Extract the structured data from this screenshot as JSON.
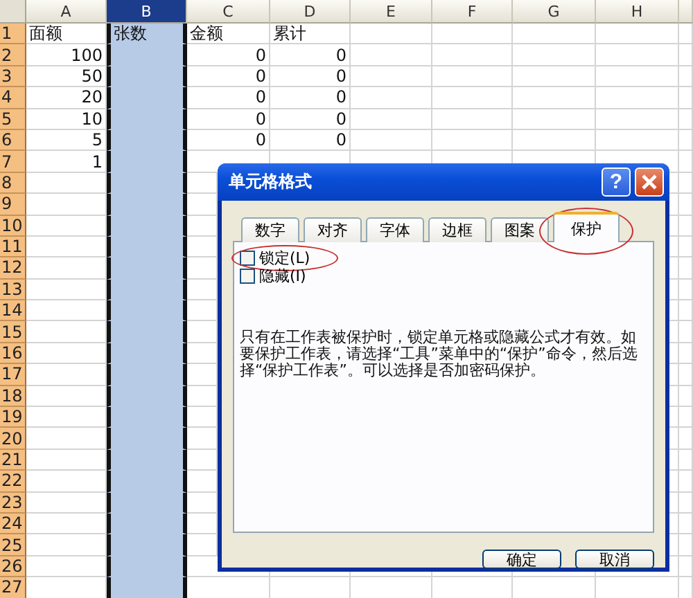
{
  "columns": [
    {
      "label": "A",
      "selected": false
    },
    {
      "label": "B",
      "selected": true
    },
    {
      "label": "C",
      "selected": false
    },
    {
      "label": "D",
      "selected": false
    },
    {
      "label": "E",
      "selected": false
    },
    {
      "label": "F",
      "selected": false
    },
    {
      "label": "G",
      "selected": false
    },
    {
      "label": "H",
      "selected": false
    }
  ],
  "rows": [
    {
      "label": "1",
      "kind": "text",
      "cells": [
        "面额",
        "张数",
        "金额",
        "累计"
      ]
    },
    {
      "label": "2",
      "kind": "number",
      "cells": [
        "100",
        "",
        "0",
        "0"
      ]
    },
    {
      "label": "3",
      "kind": "number",
      "cells": [
        "50",
        "",
        "0",
        "0"
      ]
    },
    {
      "label": "4",
      "kind": "number",
      "cells": [
        "20",
        "",
        "0",
        "0"
      ]
    },
    {
      "label": "5",
      "kind": "number",
      "cells": [
        "10",
        "",
        "0",
        "0"
      ]
    },
    {
      "label": "6",
      "kind": "number",
      "cells": [
        "5",
        "",
        "0",
        "0"
      ]
    },
    {
      "label": "7",
      "kind": "number",
      "cells": [
        "1"
      ]
    },
    {
      "label": "8"
    },
    {
      "label": "9"
    },
    {
      "label": "10"
    },
    {
      "label": "11"
    },
    {
      "label": "12"
    },
    {
      "label": "13"
    },
    {
      "label": "14"
    },
    {
      "label": "15"
    },
    {
      "label": "16"
    },
    {
      "label": "17"
    },
    {
      "label": "18"
    },
    {
      "label": "19"
    },
    {
      "label": "20"
    },
    {
      "label": "21"
    },
    {
      "label": "22"
    },
    {
      "label": "23"
    },
    {
      "label": "24"
    },
    {
      "label": "25"
    },
    {
      "label": "26"
    },
    {
      "label": "27"
    }
  ],
  "dialog": {
    "title": "单元格格式",
    "help_button": "?",
    "tabs": [
      {
        "label": "数字",
        "selected": false,
        "circled": false
      },
      {
        "label": "对齐",
        "selected": false,
        "circled": false
      },
      {
        "label": "字体",
        "selected": false,
        "circled": false
      },
      {
        "label": "边框",
        "selected": false,
        "circled": false
      },
      {
        "label": "图案",
        "selected": false,
        "circled": false
      },
      {
        "label": "保护",
        "selected": true,
        "circled": true
      }
    ],
    "options": [
      {
        "label": "锁定(L)",
        "checked": false,
        "circled": true
      },
      {
        "label": "隐藏(I)",
        "checked": false,
        "circled": false
      }
    ],
    "note": "只有在工作表被保护时，锁定单元格或隐藏公式才有效。如要保护工作表，请选择“工具”菜单中的“保护”命令，然后选择“保护工作表”。可以选择是否加密码保护。",
    "buttons": [
      "确定",
      "取消"
    ]
  }
}
